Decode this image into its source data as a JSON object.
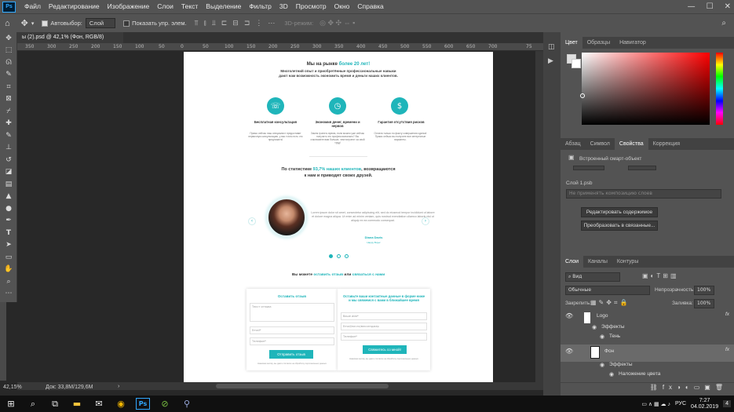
{
  "app": {
    "logo": "Ps"
  },
  "menu": [
    "Файл",
    "Редактирование",
    "Изображение",
    "Слои",
    "Текст",
    "Выделение",
    "Фильтр",
    "3D",
    "Просмотр",
    "Окно",
    "Справка"
  ],
  "options": {
    "autoselect_label": "Автовыбор:",
    "autoselect_value": "Слой",
    "show_controls_label": "Показать упр. элем.",
    "mode_3d": "3D-режим:"
  },
  "doc_tab": "ы (2).psd @ 42,1% (Фон, RGB/8)",
  "ruler_ticks": [
    "350",
    "300",
    "250",
    "200",
    "150",
    "100",
    "50",
    "0",
    "50",
    "100",
    "150",
    "200",
    "250",
    "300",
    "350",
    "400",
    "450",
    "500",
    "550",
    "600",
    "650",
    "700",
    "75"
  ],
  "status": {
    "zoom": "42,15%",
    "doc": "Док: 33,8М/129,6М"
  },
  "tools": [
    "move",
    "marquee",
    "lasso",
    "quick-select",
    "crop",
    "frame",
    "eyedropper",
    "heal",
    "brush",
    "stamp",
    "history",
    "eraser",
    "gradient",
    "blur",
    "dodge",
    "pen",
    "type",
    "path-select",
    "rect",
    "hand",
    "zoom",
    "more"
  ],
  "panels": {
    "color_tabs": [
      "Цвет",
      "Образцы",
      "Навигатор"
    ],
    "props_tabs": [
      "Абзац",
      "Символ",
      "Свойства",
      "Коррекция"
    ],
    "smart_object": "Встроенный смарт-объект",
    "file_name": "Слой 1.psb",
    "comp_placeholder": "Не применять композицию слоев",
    "edit_contents": "Редактировать содержимое",
    "convert_linked": "Преобразовать в связанные...",
    "layers_tabs": [
      "Слои",
      "Каналы",
      "Контуры"
    ],
    "kind_label": "Вид",
    "blend_mode": "Обычные",
    "opacity_label": "Непрозрачность:",
    "opacity_value": "100%",
    "lock_label": "Закрепить:",
    "fill_label": "Заливка:",
    "fill_value": "100%",
    "layers": [
      {
        "name": "Logo"
      },
      {
        "name": "Эффекты"
      },
      {
        "name": "Тень"
      },
      {
        "name": "Фон"
      },
      {
        "name": "Эффекты"
      },
      {
        "name": "Наложение цвета"
      }
    ]
  },
  "doc": {
    "headline_a": "Мы на рынке ",
    "headline_b": "более 20 лет!",
    "subline": "Многолетний опыт и приобретённые профессиональные навыки дают нам возможность экономить время и деньги наших клиентов.",
    "features": [
      {
        "title": "Бесплатная консультация",
        "text": "Прямо сейчас наш специалист предоставит первичную консультацию, у вас точно есть что предложить!"
      },
      {
        "title": "Экономия денег, времени и нервов",
        "text": "Зачем тратить время, если можно уже сейчас получить это профессионально? Вы сэкономите вам больше, чем потратит за свой труд!"
      },
      {
        "title": "Гарантия отсутствия рисков",
        "text": "Оплата только по факту совершения сделки! Прямо сейчас вы получите все интересные варианты."
      }
    ],
    "stats_a": "По статистике ",
    "stats_b": "93,7% наших клиентов",
    "stats_c": ", возвращаются",
    "stats_d": "к нам и приводят своих друзей.",
    "testimonial": "Lorem ipsum dolor sit amet, consectetur adipiscing elit, sed do eiusmod tempor incididunt ut labore et dolore magna aliqua. Ut enim ad minim veniam, quis nostrud exercitation ullamco laboris nisi ut aliquip ex ea commodo consequat.",
    "person_name": "Diana Davis",
    "person_role": "Happy Buyer",
    "cta_a": "Вы можете ",
    "cta_b": "оставить отзыв",
    "cta_c": " или ",
    "cta_d": "связаться с нами",
    "form_left": {
      "title": "Оставить отзыв",
      "ph1": "Текст отзыва",
      "ph2": "Email*",
      "ph3": "Телефон*",
      "button": "Отправить отзыв",
      "note": "Нажимая кнопку, вы даете согласие на обработку персональных данных"
    },
    "form_right": {
      "title": "Оставьте ваши контактные данные в форме ниже и мы свяжемся с вами в ближайшее время",
      "ph1": "Ваше имя*",
      "ph2": "Email/почта/мессенджер",
      "ph3": "Телефон*",
      "button": "Свяжитесь со мной!",
      "note": "Нажимая кнопку, вы даете согласие на обработку персональных данных"
    }
  },
  "clock": {
    "time": "7:27",
    "date": "04.02.2019",
    "lang": "РУС",
    "badge": "4"
  }
}
